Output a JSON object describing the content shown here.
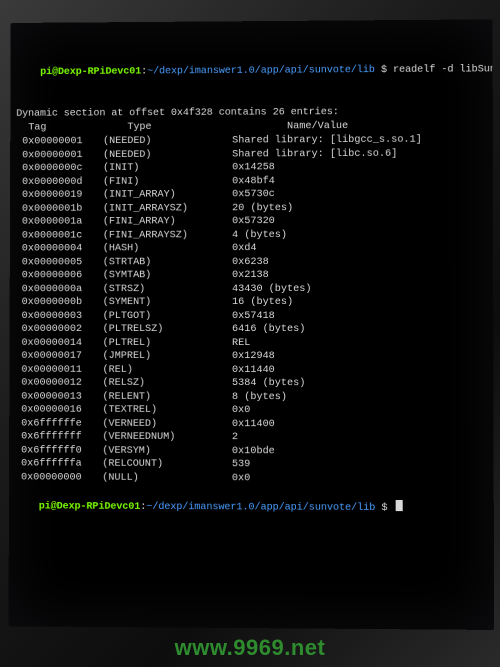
{
  "prompt1": {
    "userhost": "pi@Dexp-RPiDevc01",
    "sep": ":",
    "path": "~/dexp/imanswer1.0/app/api/sunvote/lib",
    "dollar": " $ ",
    "cmd": "readelf -d libSunV"
  },
  "section_line": "Dynamic section at offset 0x4f328 contains 26 entries:",
  "columns": {
    "c1": "  Tag",
    "c2": "    Type",
    "c3": "         Name/Value"
  },
  "rows": [
    {
      "tag": " 0x00000001",
      "type": "(NEEDED)",
      "val": "Shared library: [libgcc_s.so.1]"
    },
    {
      "tag": " 0x00000001",
      "type": "(NEEDED)",
      "val": "Shared library: [libc.so.6]"
    },
    {
      "tag": " 0x0000000c",
      "type": "(INIT)",
      "val": "0x14258"
    },
    {
      "tag": " 0x0000000d",
      "type": "(FINI)",
      "val": "0x48bf4"
    },
    {
      "tag": " 0x00000019",
      "type": "(INIT_ARRAY)",
      "val": "0x5730c"
    },
    {
      "tag": " 0x0000001b",
      "type": "(INIT_ARRAYSZ)",
      "val": "20 (bytes)"
    },
    {
      "tag": " 0x0000001a",
      "type": "(FINI_ARRAY)",
      "val": "0x57320"
    },
    {
      "tag": " 0x0000001c",
      "type": "(FINI_ARRAYSZ)",
      "val": "4 (bytes)"
    },
    {
      "tag": " 0x00000004",
      "type": "(HASH)",
      "val": "0xd4"
    },
    {
      "tag": " 0x00000005",
      "type": "(STRTAB)",
      "val": "0x6238"
    },
    {
      "tag": " 0x00000006",
      "type": "(SYMTAB)",
      "val": "0x2138"
    },
    {
      "tag": " 0x0000000a",
      "type": "(STRSZ)",
      "val": "43430 (bytes)"
    },
    {
      "tag": " 0x0000000b",
      "type": "(SYMENT)",
      "val": "16 (bytes)"
    },
    {
      "tag": " 0x00000003",
      "type": "(PLTGOT)",
      "val": "0x57418"
    },
    {
      "tag": " 0x00000002",
      "type": "(PLTRELSZ)",
      "val": "6416 (bytes)"
    },
    {
      "tag": " 0x00000014",
      "type": "(PLTREL)",
      "val": "REL"
    },
    {
      "tag": " 0x00000017",
      "type": "(JMPREL)",
      "val": "0x12948"
    },
    {
      "tag": " 0x00000011",
      "type": "(REL)",
      "val": "0x11440"
    },
    {
      "tag": " 0x00000012",
      "type": "(RELSZ)",
      "val": "5384 (bytes)"
    },
    {
      "tag": " 0x00000013",
      "type": "(RELENT)",
      "val": "8 (bytes)"
    },
    {
      "tag": " 0x00000016",
      "type": "(TEXTREL)",
      "val": "0x0"
    },
    {
      "tag": " 0x6ffffffe",
      "type": "(VERNEED)",
      "val": "0x11400"
    },
    {
      "tag": " 0x6fffffff",
      "type": "(VERNEEDNUM)",
      "val": "2"
    },
    {
      "tag": " 0x6ffffff0",
      "type": "(VERSYM)",
      "val": "0x10bde"
    },
    {
      "tag": " 0x6ffffffa",
      "type": "(RELCOUNT)",
      "val": "539"
    },
    {
      "tag": " 0x00000000",
      "type": "(NULL)",
      "val": "0x0"
    }
  ],
  "prompt2": {
    "userhost": "pi@Dexp-RPiDevc01",
    "sep": ":",
    "path": "~/dexp/imanswer1.0/app/api/sunvote/lib",
    "dollar": " $ "
  },
  "watermark": "www.9969.net"
}
